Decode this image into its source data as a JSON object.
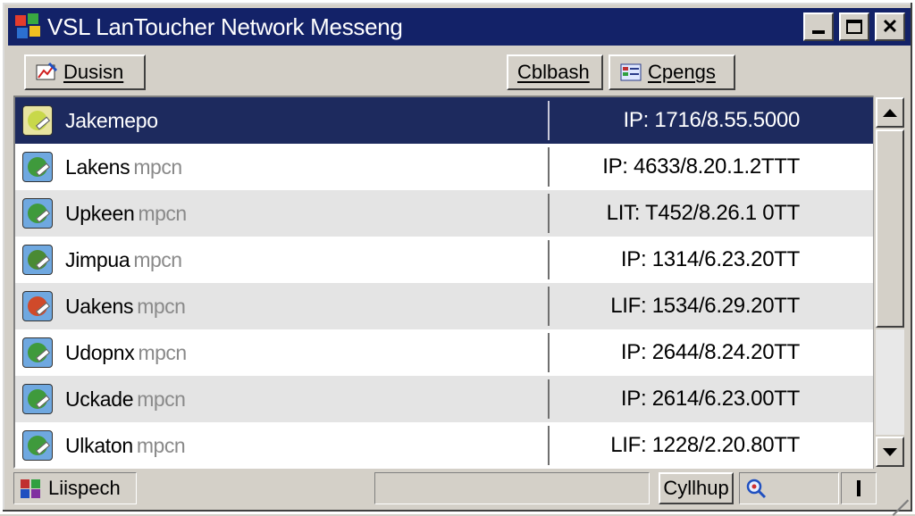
{
  "window": {
    "title": "VSL LanToucher Network Messeng"
  },
  "toolbar": {
    "left_button": "Dusisn",
    "middle_button": "Cblbash",
    "right_button": "Cpengs"
  },
  "contacts": [
    {
      "name": "Jakemepo",
      "suffix": "",
      "ip": "IP: 1716/8.55.5000",
      "selected": true,
      "avatar_color": "#c8d84a"
    },
    {
      "name": "Lakens",
      "suffix": "mpcn",
      "ip": "IP: 4633/8.20.1.2TTT",
      "selected": false,
      "avatar_color": "#3f9a3c"
    },
    {
      "name": "Upkeen",
      "suffix": "mpcn",
      "ip": "LIT: T452/8.26.1 0TT",
      "selected": false,
      "avatar_color": "#3f9a3c"
    },
    {
      "name": "Jimpua",
      "suffix": "mpcn",
      "ip": "IP: 1314/6.23.20TT",
      "selected": false,
      "avatar_color": "#4a8a34"
    },
    {
      "name": "Uakens",
      "suffix": "mpcn",
      "ip": "LIF: 1534/6.29.20TT",
      "selected": false,
      "avatar_color": "#d04a2a"
    },
    {
      "name": "Udopnx",
      "suffix": "mpcn",
      "ip": "IP: 2644/8.24.20TT",
      "selected": false,
      "avatar_color": "#3f9a3c"
    },
    {
      "name": "Uckade",
      "suffix": "mpcn",
      "ip": "IP: 2614/6.23.00TT",
      "selected": false,
      "avatar_color": "#3f9a3c"
    },
    {
      "name": "Ulkaton",
      "suffix": "mpcn",
      "ip": "LIF: 1228/2.20.80TT",
      "selected": false,
      "avatar_color": "#3f9a3c"
    }
  ],
  "statusbar": {
    "left_label": "Liispech",
    "help_button": "Cyllhup"
  },
  "colors": {
    "titlebar": "#132268",
    "selection": "#1d2a5e",
    "chrome": "#d4d0c8"
  }
}
